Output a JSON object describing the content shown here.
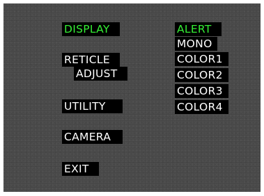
{
  "main_menu": {
    "items": [
      {
        "id": "display",
        "label": "DISPLAY",
        "selected": true
      },
      {
        "id": "reticle",
        "label": "RETICLE",
        "label2": "ADJUST",
        "selected": false
      },
      {
        "id": "utility",
        "label": "UTILITY",
        "selected": false
      },
      {
        "id": "camera",
        "label": "CAMERA",
        "selected": false
      },
      {
        "id": "exit",
        "label": "EXIT",
        "selected": false
      }
    ]
  },
  "display_submenu": {
    "items": [
      {
        "id": "alert",
        "label": "ALERT",
        "selected": true
      },
      {
        "id": "mono",
        "label": "MONO",
        "selected": false
      },
      {
        "id": "color1",
        "label": "COLOR1",
        "selected": false
      },
      {
        "id": "color2",
        "label": "COLOR2",
        "selected": false
      },
      {
        "id": "color3",
        "label": "COLOR3",
        "selected": false
      },
      {
        "id": "color4",
        "label": "COLOR4",
        "selected": false
      }
    ]
  },
  "colors": {
    "selected_text": "#35ef35",
    "normal_text": "#ffffff",
    "label_background": "#000000",
    "screen_background": "#474747"
  }
}
